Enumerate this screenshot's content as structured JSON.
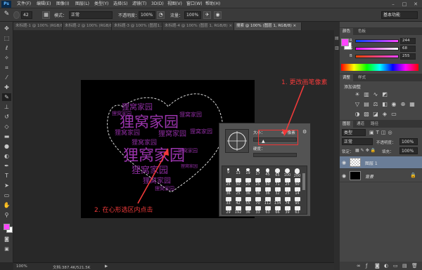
{
  "menubar": {
    "logo": "Ps",
    "items": [
      "文件(F)",
      "编辑(E)",
      "图像(I)",
      "图层(L)",
      "类型(Y)",
      "选择(S)",
      "滤镜(T)",
      "3D(D)",
      "视图(V)",
      "窗口(W)",
      "帮助(H)"
    ],
    "window_controls": [
      "–",
      "□",
      "✕"
    ]
  },
  "options": {
    "brush_size": "42",
    "mode_label": "模式：",
    "mode_value": "正常",
    "opacity_label": "不透明度：",
    "opacity_value": "100%",
    "flow_label": "流量：",
    "flow_value": "100%",
    "workspace": "基本功能"
  },
  "tabs": [
    "未标题-1 @ 100% (RGB/8...",
    "未标题-2 @ 100% (RGB/8...",
    "未标题-3 @ 100% (图层1...",
    "未标题-4 @ 100% (图层 1, RGB/8) ×",
    "搜索 @ 100% (图层 1, RGB/8) ×"
  ],
  "colors": {
    "foreground": "#ff44ff",
    "background": "#ffffff",
    "wordcloud": "#8a2c9c",
    "annotation": "#f03a3a"
  },
  "tools": [
    "move-icon",
    "marquee-icon",
    "lasso-icon",
    "quick-select-icon",
    "crop-icon",
    "eyedropper-icon",
    "healing-icon",
    "brush-icon",
    "stamp-icon",
    "history-brush-icon",
    "eraser-icon",
    "gradient-icon",
    "blur-icon",
    "dodge-icon",
    "pen-icon",
    "type-icon",
    "path-select-icon",
    "shape-icon",
    "hand-icon",
    "zoom-icon"
  ],
  "canvas": {
    "words": [
      "狸窝家园",
      "狸窝家园",
      "狸窝家园",
      "狸窝家园",
      "狸窝家园",
      "狸窝家园",
      "狸窝家园",
      "狸窝家园",
      "狸窝家园",
      "狸窝家园",
      "狸窝家园",
      "狸窝家园",
      "狸窝家园",
      "狸窝家园"
    ]
  },
  "brush_popup": {
    "size_label": "大小：",
    "size_value": "42 像素",
    "hardness_label": "硬度：",
    "presets": [
      {
        "n": "9"
      },
      {
        "n": "13"
      },
      {
        "n": "19"
      },
      {
        "n": "17"
      },
      {
        "n": "45"
      },
      {
        "n": "65"
      },
      {
        "n": "100"
      },
      {
        "n": "200"
      },
      {
        "n": "25"
      },
      {
        "n": "50"
      },
      {
        "n": "25"
      },
      {
        "n": "25"
      },
      {
        "n": "50"
      },
      {
        "n": "71"
      },
      {
        "n": "25"
      },
      {
        "n": "50"
      },
      {
        "n": "36"
      },
      {
        "n": "25"
      },
      {
        "n": "36"
      },
      {
        "n": "36"
      },
      {
        "n": "36"
      },
      {
        "n": "32"
      },
      {
        "n": "25"
      },
      {
        "n": "14"
      },
      {
        "n": "33"
      },
      {
        "n": "42"
      },
      {
        "n": "55"
      },
      {
        "n": "70"
      },
      {
        "n": "112"
      },
      {
        "n": "134"
      },
      {
        "n": "74"
      },
      {
        "n": "95"
      },
      {
        "n": "29"
      },
      {
        "n": "192"
      },
      {
        "n": "36"
      },
      {
        "n": "33"
      },
      {
        "n": "63"
      },
      {
        "n": "66"
      },
      {
        "n": "39"
      },
      {
        "n": "63"
      }
    ]
  },
  "annotations": {
    "note1": "1. 更改画笔像素",
    "note2": "2. 在心形选区内点击"
  },
  "status": {
    "zoom": "100%",
    "doc": "文档:387.4K/521.5K"
  },
  "color_panel": {
    "tabs": [
      "颜色",
      "色板"
    ],
    "r": "244",
    "g": "68",
    "b": "255"
  },
  "adjust_panel": {
    "tabs": [
      "调整",
      "样式"
    ],
    "title": "添加调整"
  },
  "layers_panel": {
    "tabs": [
      "图层",
      "通道",
      "路径"
    ],
    "kind_filter": "类型",
    "blend": "正常",
    "opacity_label": "不透明度：",
    "opacity": "100%",
    "lock_label": "锁定：",
    "fill_label": "填充：",
    "fill": "100%",
    "layers": [
      "图层 1",
      "背景"
    ]
  }
}
